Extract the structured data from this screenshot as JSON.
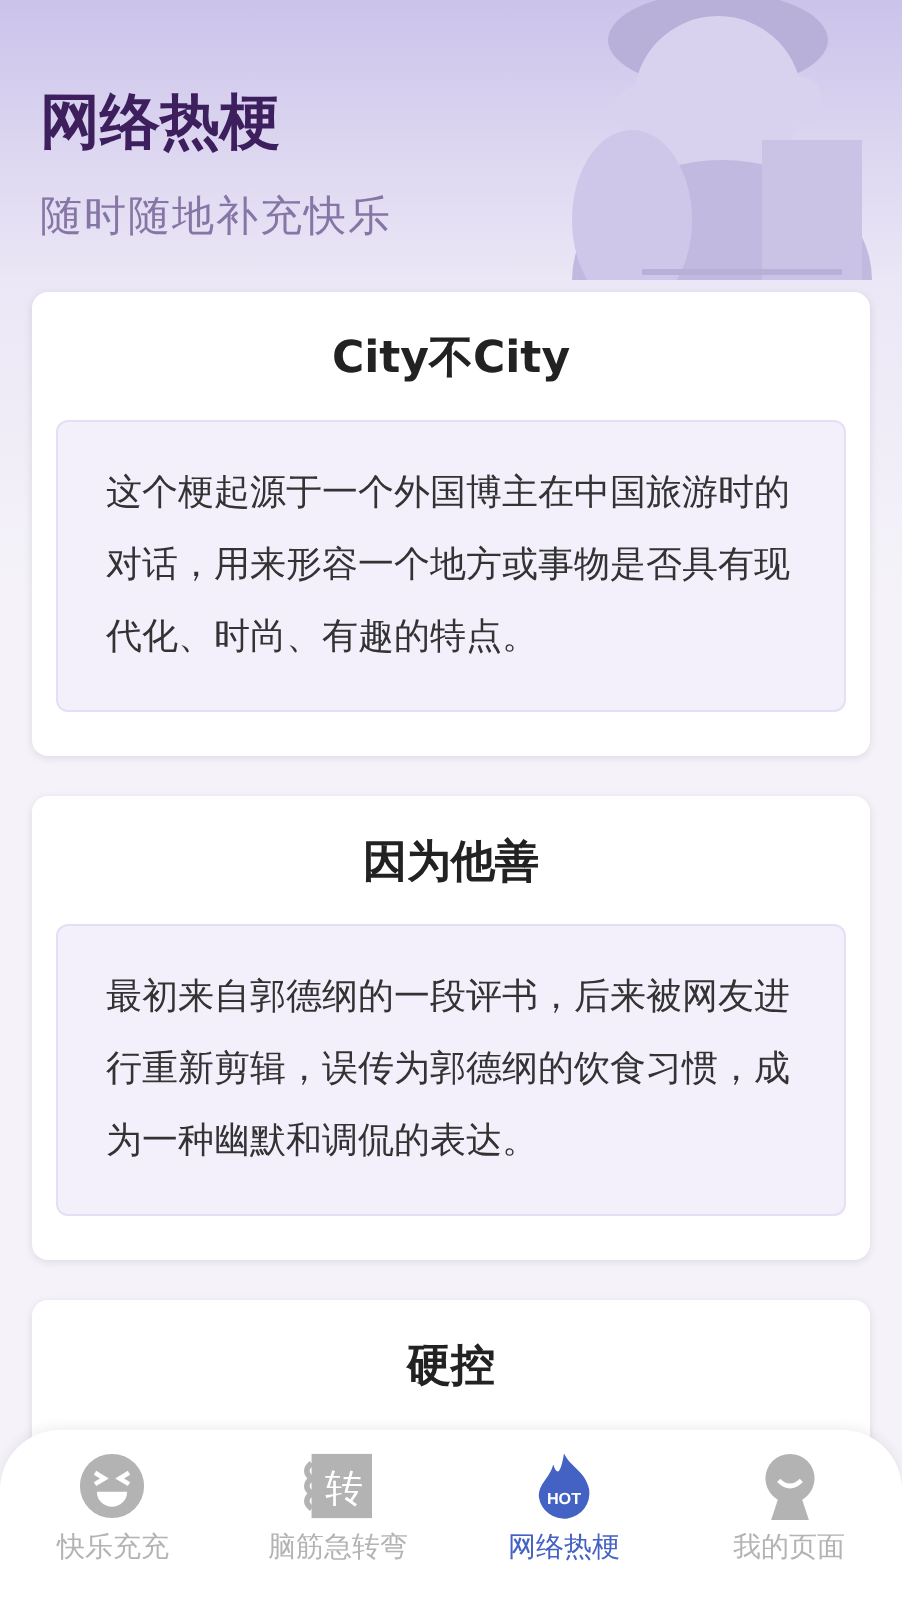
{
  "header": {
    "title": "网络热梗",
    "subtitle": "随时随地补充快乐",
    "kind": "picture"
  },
  "cards": [
    {
      "title": "City不City",
      "description": "这个梗起源于一个外国博主在中国旅游时的对话，用来形容一个地方或事物是否具有现代化、时尚、有趣的特点。"
    },
    {
      "title": "因为他善",
      "description": "最初来自郭德纲的一段评书，后来被网友进行重新剪辑，误传为郭德纲的饮食习惯，成为一种幽默和调侃的表达。"
    },
    {
      "title": "硬控"
    }
  ],
  "tab_bar": [
    {
      "label": "快乐充充",
      "kind": "smiley",
      "selected": false
    },
    {
      "label": "脑筋急转弯",
      "kind": "brain",
      "icon_text": "转",
      "selected": false
    },
    {
      "label": "网络热梗",
      "kind": "hot",
      "icon_text": "HOT",
      "selected": true
    },
    {
      "label": "我的页面",
      "kind": "user",
      "selected": false
    }
  ]
}
